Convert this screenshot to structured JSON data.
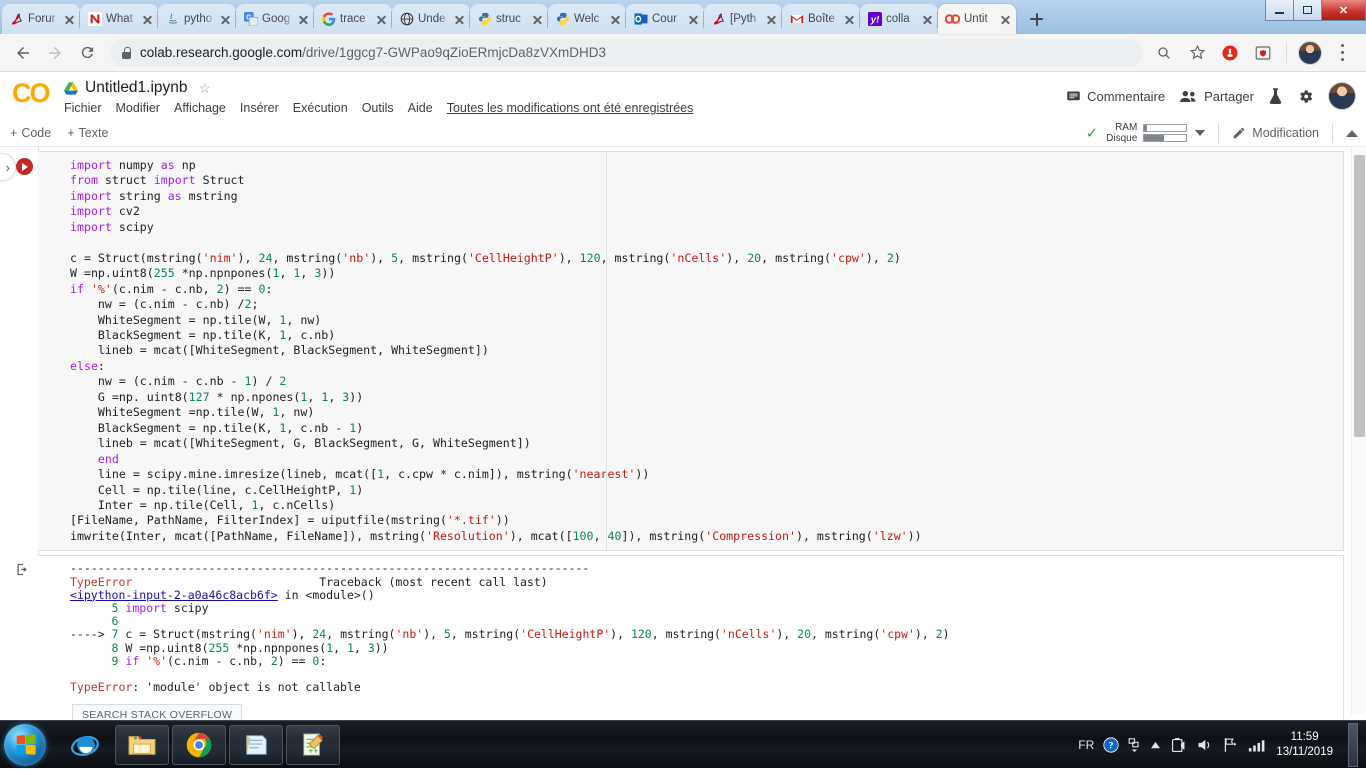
{
  "browser": {
    "tabs": [
      {
        "title": "Forur",
        "icon": "acrobat-icon",
        "active": false
      },
      {
        "title": "What",
        "icon": "nero-icon",
        "active": false
      },
      {
        "title": "pytho",
        "icon": "java-icon",
        "active": false
      },
      {
        "title": "Goog",
        "icon": "google-translate-icon",
        "active": false
      },
      {
        "title": "trace",
        "icon": "google-icon",
        "active": false
      },
      {
        "title": "Unde",
        "icon": "globe-icon",
        "active": false
      },
      {
        "title": "struc",
        "icon": "python-icon",
        "active": false
      },
      {
        "title": "Welc",
        "icon": "python-icon",
        "active": false
      },
      {
        "title": "Cour",
        "icon": "outlook-icon",
        "active": false
      },
      {
        "title": "[Pyth",
        "icon": "acrobat-icon",
        "active": false
      },
      {
        "title": "Boîte",
        "icon": "gmail-icon",
        "active": false
      },
      {
        "title": "colla",
        "icon": "yahoo-icon",
        "active": false
      },
      {
        "title": "Untit",
        "icon": "colab-icon",
        "active": true
      }
    ],
    "newtab_label": "+",
    "window_controls": {
      "minimize": "minimize-icon",
      "restore": "restore-icon",
      "close": "✕"
    },
    "nav": {
      "back": "←",
      "forward": "→",
      "reload": "⟳"
    },
    "omnibox": {
      "domain": "colab.research.google.com",
      "path": "/drive/1ggcg7-GWPao9qZioERmjcDa8zVXmDHD3",
      "lock": "lock-icon"
    },
    "right_actions": [
      "search-icon",
      "bookmark-star-icon",
      "adblock-icon",
      "shield-extension-icon",
      "profile-avatar",
      "chrome-menu-icon"
    ]
  },
  "colab": {
    "logo": "CO",
    "notebook_title": "Untitled1.ipynb",
    "star": "☆",
    "menu": [
      "Fichier",
      "Modifier",
      "Affichage",
      "Insérer",
      "Exécution",
      "Outils",
      "Aide"
    ],
    "saved_note": "Toutes les modifications ont été enregistrées",
    "header_actions": {
      "comment": "Commentaire",
      "share": "Partager",
      "flask": "flask-icon",
      "settings": "gear-icon",
      "account": "account-avatar"
    },
    "toolbar": {
      "add_code": "Code",
      "add_text": "Texte",
      "ram_label": "RAM",
      "disk_label": "Disque",
      "ram_percent": 6,
      "disk_percent": 48,
      "connected_check": "✓",
      "edit_label": "Modification",
      "collapse": "chevron-up-icon"
    }
  },
  "code_cell": {
    "run_button": "run-cell-button",
    "lines": [
      "import numpy as np",
      "from struct import Struct",
      "import string as mstring",
      "import cv2",
      "import scipy",
      "",
      "c = Struct(mstring('nim'), 24, mstring('nb'), 5, mstring('CellHeightP'), 120, mstring('nCells'), 20, mstring('cpw'), 2)",
      "W =np.uint8(255 *np.npnpones(1, 1, 3))",
      "if '%'(c.nim - c.nb, 2) == 0:",
      "    nw = (c.nim - c.nb) /2;",
      "    WhiteSegment = np.tile(W, 1, nw)",
      "    BlackSegment = np.tile(K, 1, c.nb)",
      "    lineb = mcat([WhiteSegment, BlackSegment, WhiteSegment])",
      "else:",
      "    nw = (c.nim - c.nb - 1) / 2",
      "    G =np. uint8(127 * np.npones(1, 1, 3))",
      "    WhiteSegment =np.tile(W, 1, nw)",
      "    BlackSegment = np.tile(K, 1, c.nb - 1)",
      "    lineb = mcat([WhiteSegment, G, BlackSegment, G, WhiteSegment])",
      "    end",
      "    line = scipy.mine.imresize(lineb, mcat([1, c.cpw * c.nim]), mstring('nearest'))",
      "    Cell = np.tile(line, c.CellHeightP, 1)",
      "    Inter = np.tile(Cell, 1, c.nCells)",
      "[FileName, PathName, FilterIndex] = uiputfile(mstring('*.tif'))",
      "imwrite(Inter, mcat([PathName, FileName]), mstring('Resolution'), mcat([100, 40]), mstring('Compression'), mstring('lzw'))"
    ]
  },
  "output_cell": {
    "gutter_icon": "output-icon",
    "separator": "---------------------------------------------------------------------------",
    "error_type": "TypeError",
    "traceback_header": "Traceback (most recent call last)",
    "source_link": "<ipython-input-2-a0a46c8acb6f>",
    "source_in": "in",
    "source_module": "<module>()",
    "frames": [
      {
        "marker": "",
        "no": "5",
        "text": "import scipy"
      },
      {
        "marker": "",
        "no": "6",
        "text": ""
      },
      {
        "marker": "----> ",
        "no": "7",
        "text": "c = Struct(mstring('nim'), 24, mstring('nb'), 5, mstring('CellHeightP'), 120, mstring('nCells'), 20, mstring('cpw'), 2)"
      },
      {
        "marker": "",
        "no": "8",
        "text": "W =np.uint8(255 *np.npnpones(1, 1, 3))"
      },
      {
        "marker": "",
        "no": "9",
        "text": "if '%'(c.nim - c.nb, 2) == 0:"
      }
    ],
    "error_message_name": "TypeError",
    "error_message_text": ": 'module' object is not callable",
    "search_button": "SEARCH STACK OVERFLOW"
  },
  "taskbar": {
    "start": "windows-start-orb",
    "items": [
      "internet-explorer-icon",
      "file-explorer-icon",
      "chrome-icon",
      "notepad-icon",
      "notepad-plus-plus-icon"
    ],
    "tray": {
      "language": "FR",
      "help": "?",
      "show_hidden": "▲",
      "battery": "battery-icon",
      "volume": "volume-icon",
      "network": "network-icon",
      "signal": "signal-icon",
      "time": "11:59",
      "date": "13/11/2019"
    }
  },
  "colors": {
    "colab_orange": "#F9AB00",
    "error_red": "#c0392b",
    "link_blue": "#1a0dab",
    "keyword_purple": "#a020f0",
    "string_red": "#c41a16",
    "number_green": "#098658"
  }
}
